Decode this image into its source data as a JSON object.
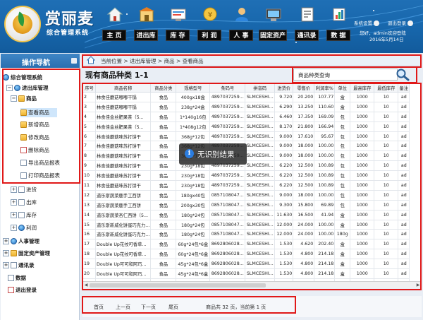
{
  "header": {
    "brand_name": "赏丽麦",
    "brand_sub": "综合管理系统",
    "nav": [
      {
        "label": "主 页",
        "icon": "home-icon"
      },
      {
        "label": "进出库",
        "icon": "warehouse-icon"
      },
      {
        "label": "库 存",
        "icon": "inventory-icon"
      },
      {
        "label": "利 润",
        "icon": "profit-icon"
      },
      {
        "label": "人 事",
        "icon": "personnel-icon"
      },
      {
        "label": "固定资产",
        "icon": "assets-icon"
      },
      {
        "label": "通讯录",
        "icon": "contacts-icon"
      },
      {
        "label": "数 据",
        "icon": "data-icon"
      }
    ],
    "system_settings": "系统设置",
    "logout": "退出登录",
    "welcome": "您好，admin欢迎登陆",
    "date": "2016年5月14日"
  },
  "sidebar": {
    "title": "操作导航",
    "root": "综合管理系统",
    "inout": "进出库管理",
    "goods": "商品",
    "goods_items": [
      "查看商品",
      "新增商品",
      "修改商品",
      "删除商品",
      "导出商品报表",
      "打印商品报表"
    ],
    "inout_items": [
      "进货",
      "出库",
      "库存",
      "利润"
    ],
    "top_items": [
      "人事管理",
      "固定资产管理",
      "通讯录",
      "数据",
      "退出登录"
    ]
  },
  "breadcrumb": "当前位置 > 进出库管理 > 商品 > 查看商品",
  "table_title": "现有商品种类 1-1",
  "search": {
    "label": "商品种类查询",
    "placeholder": ""
  },
  "columns": [
    "序号",
    "商品名称",
    "商品分类",
    "规格型号",
    "条码号",
    "拼音码",
    "进货价",
    "零售价",
    "利润率%",
    "单位",
    "最高库存",
    "最低库存",
    "备注"
  ],
  "rows": [
    [
      "2",
      "林食佳蘑菇嘟嘟干锅",
      "食品",
      "400gx18盒",
      "4897037259...",
      "SLMCESHI...",
      "9.720",
      "20.200",
      "107.77",
      "盒",
      "1000",
      "10",
      "ad"
    ],
    [
      "3",
      "林食佳蘑菇嘟嘟干锅",
      "食品",
      "238g*24盒",
      "4897037259...",
      "SLMCESHI...",
      "6.290",
      "13.250",
      "110.60",
      "盒",
      "1000",
      "10",
      "ad"
    ],
    [
      "4",
      "林食佳金丝肥果茶（5...",
      "食品",
      "1*140g16包",
      "4897037259...",
      "SLMCESHI...",
      "6.460",
      "17.350",
      "169.09",
      "包",
      "1000",
      "10",
      "ad"
    ],
    [
      "5",
      "林食佳金丝肥果茶（5...",
      "食品",
      "1*408g12包",
      "4897037259...",
      "SLMCESHI...",
      "8.170",
      "21.800",
      "166.94",
      "包",
      "1000",
      "10",
      "ad"
    ],
    [
      "6",
      "林食佳蘑菇味苏打饼干",
      "食品",
      "368g*12包",
      "4897037259...",
      "SLMCESHI...",
      "9.000",
      "17.610",
      "95.67",
      "包",
      "1000",
      "10",
      "ad"
    ],
    [
      "7",
      "林食佳蘑菇味苏打饼干",
      "食品",
      "368g*12包",
      "4897037259...",
      "SLMCESHI...",
      "9.000",
      "18.000",
      "100.00",
      "包",
      "1000",
      "10",
      "ad"
    ],
    [
      "8",
      "林食佳蘑菇味苏打饼干",
      "食品",
      "368g*12包",
      "4897037259...",
      "SLMCESHI...",
      "9.000",
      "18.000",
      "100.00",
      "包",
      "1000",
      "10",
      "ad"
    ],
    [
      "9",
      "林食佳蘑菇味苏打饼干",
      "食品",
      "230g*18包",
      "4897037259...",
      "SLMCESHI...",
      "6.220",
      "12.500",
      "100.89",
      "包",
      "1000",
      "10",
      "ad"
    ],
    [
      "10",
      "林食佳蘑菇味苏打饼干",
      "食品",
      "230g*18包",
      "4897037259...",
      "SLMCESHI...",
      "6.220",
      "12.500",
      "100.89",
      "包",
      "1000",
      "10",
      "ad"
    ],
    [
      "11",
      "林食佳蘑菇味苏打饼干",
      "食品",
      "230g*18包",
      "4897037259...",
      "SLMCESHI...",
      "6.220",
      "12.500",
      "100.89",
      "包",
      "1000",
      "10",
      "ad"
    ],
    [
      "12",
      "道乐斯蔬菜鹿手工西饼",
      "食品",
      "180gx40包",
      "0857108047...",
      "SLMCESHI...",
      "9.000",
      "18.000",
      "100.00",
      "包",
      "1000",
      "10",
      "ad"
    ],
    [
      "13",
      "道乐斯蔬菜鹿手工西饼",
      "食品",
      "200gx30包",
      "0857108047...",
      "SLMCESHI...",
      "9.300",
      "15.800",
      "69.89",
      "包",
      "1000",
      "10",
      "ad"
    ],
    [
      "14",
      "道乐斯蔬菜杏仁西饼（5...",
      "食品",
      "180g*24包",
      "0857108047...",
      "SLMCESHI...",
      "11.630",
      "16.500",
      "41.94",
      "盒",
      "1000",
      "10",
      "ad"
    ],
    [
      "15",
      "道乐斯新威化饼蛋巧克力...",
      "食品",
      "180g*24包",
      "0857108047...",
      "SLMCESHI...",
      "12.000",
      "24.000",
      "100.00",
      "盒",
      "1000",
      "10",
      "ad"
    ],
    [
      "16",
      "道乐斯新威化饼蛋巧克力...",
      "食品",
      "180g*24包",
      "0857108047...",
      "SLMCESHI...",
      "12.000",
      "24.000",
      "100.00",
      "180g",
      "1000",
      "10",
      "ad"
    ],
    [
      "17",
      "Double Up花纹可香草...",
      "食品",
      "60g*24包*6盒",
      "8692806028...",
      "SLMCESHI...",
      "1.530",
      "4.620",
      "202.40",
      "盒",
      "1000",
      "10",
      "ad"
    ],
    [
      "18",
      "Double Up花纹可香草...",
      "食品",
      "60g*24包*6盒",
      "8692806028...",
      "SLMCESHI...",
      "1.530",
      "4.800",
      "214.18",
      "盒",
      "1000",
      "10",
      "ad"
    ],
    [
      "19",
      "Double Up可可和阿巧...",
      "食品",
      "45g*24包*6盒",
      "8692806028...",
      "SLMCESHI...",
      "1.530",
      "4.800",
      "214.18",
      "盒",
      "1000",
      "10",
      "ad"
    ],
    [
      "20",
      "Double Up可可和阿巧...",
      "食品",
      "45g*24包*6盒",
      "8692806028...",
      "SLMCESHI...",
      "1.530",
      "4.800",
      "214.18",
      "盒",
      "1000",
      "10",
      "ad"
    ],
    [
      "21",
      "Bien花纹可可香水心腿...",
      "食品",
      "60g*24包*6盒",
      "8692806028...",
      "SLMCESHI...",
      "1.530",
      "4.800",
      "214.18",
      "盒",
      "1000",
      "10",
      "ad"
    ]
  ],
  "pager": {
    "first": "首页",
    "prev": "上一页",
    "next": "下一页",
    "last": "尾页",
    "info": "商品共 32 页，当前第 1 页"
  },
  "toast": "无识别结果",
  "colors": {
    "header_blue": "#1766ab",
    "highlight_red": "#e01818",
    "selection_blue": "#cfe6fb"
  }
}
